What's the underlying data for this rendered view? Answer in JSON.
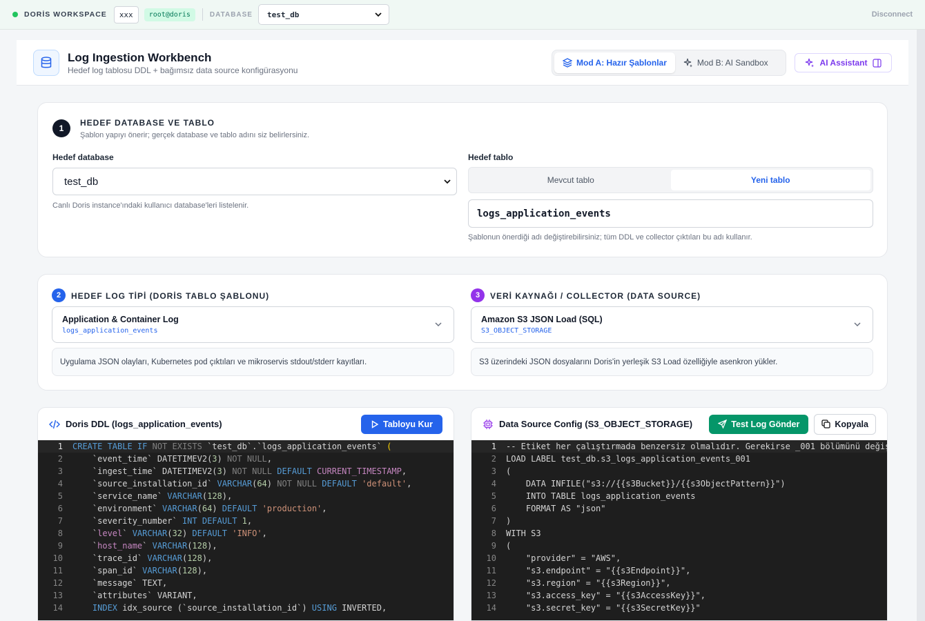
{
  "topbar": {
    "workspace": "DORİS WORKSPACE",
    "host": "xxx",
    "user": "root@doris",
    "db_label": "DATABASE",
    "db_value": "test_db",
    "disconnect": "Disconnect"
  },
  "header": {
    "title": "Log Ingestion Workbench",
    "subtitle": "Hedef log tablosu DDL + bağımsız data source konfigürasyonu",
    "mode_a": "Mod A: Hazır Şablonlar",
    "mode_b": "Mod B: AI Sandbox",
    "ai_assistant": "AI Assistant"
  },
  "section1": {
    "number": "1",
    "title": "HEDEF DATABASE VE TABLO",
    "subtitle": "Şablon yapıyı önerir; gerçek database ve tablo adını siz belirlersiniz.",
    "db_label": "Hedef database",
    "db_value": "test_db",
    "db_hint": "Canlı Doris instance'ındaki kullanıcı database'leri listelenir.",
    "table_label": "Hedef tablo",
    "tab_existing": "Mevcut tablo",
    "tab_new": "Yeni tablo",
    "table_value": "logs_application_events",
    "table_hint": "Şablonun önerdiği adı değiştirebilirsiniz; tüm DDL ve collector çıktıları bu adı kullanır."
  },
  "section2": {
    "number": "2",
    "title": "HEDEF LOG TİPİ (DORİS TABLO ŞABLONU)",
    "selected_title": "Application & Container Log",
    "selected_sub": "logs_application_events",
    "description": "Uygulama JSON olayları, Kubernetes pod çıktıları ve mikroservis stdout/stderr kayıtları."
  },
  "section3": {
    "number": "3",
    "title": "VERİ KAYNAĞI / COLLECTOR (DATA SOURCE)",
    "selected_title": "Amazon S3 JSON Load (SQL)",
    "selected_sub": "S3_OBJECT_STORAGE",
    "description": "S3 üzerindeki JSON dosyalarını Doris'in yerleşik S3 Load özelliğiyle asenkron yükler."
  },
  "ddl_panel": {
    "title": "Doris DDL (logs_application_events)",
    "button": "Tabloyu Kur"
  },
  "config_panel": {
    "title": "Data Source Config (S3_OBJECT_STORAGE)",
    "send_button": "Test Log Gönder",
    "copy_button": "Kopyala"
  },
  "colors": {
    "accent_blue": "#2563eb",
    "accent_green": "#059669",
    "accent_purple": "#7c3aed",
    "status_green": "#22c55e"
  }
}
